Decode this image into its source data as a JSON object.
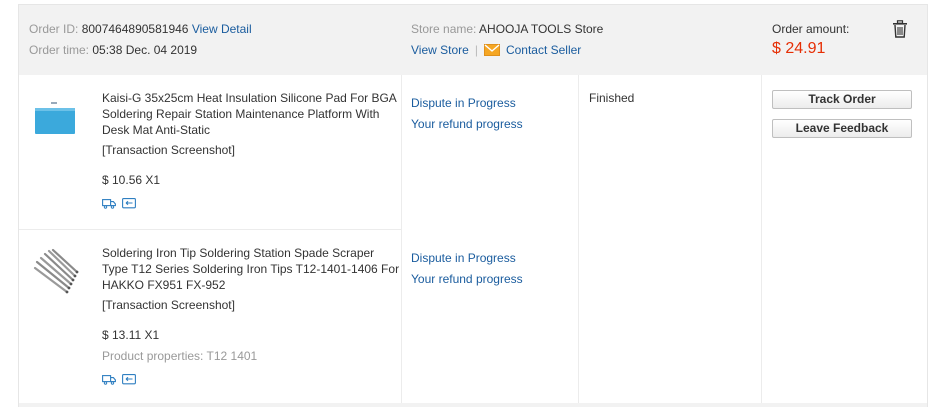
{
  "header": {
    "order_id_label": "Order ID:",
    "order_id": "8007464890581946",
    "view_detail": "View Detail",
    "order_time_label": "Order time:",
    "order_time": "05:38 Dec. 04 2019",
    "store_name_label": "Store name:",
    "store_name": "AHOOJA TOOLS Store",
    "view_store": "View Store",
    "separator": "|",
    "contact_seller": "Contact Seller",
    "order_amount_label": "Order amount:",
    "order_amount": "$ 24.91"
  },
  "items": [
    {
      "title": "Kaisi-G 35x25cm Heat Insulation Silicone Pad For BGA Soldering Repair Station Maintenance Platform With Desk Mat Anti-Static",
      "screenshot_link": "[Transaction Screenshot]",
      "price": "$ 10.56 X1",
      "dispute": "Dispute in Progress",
      "refund": "Your refund progress"
    },
    {
      "title": "Soldering Iron Tip Soldering Station Spade Scraper Type T12 Series Soldering Iron Tips T12-1401-1406 For HAKKO FX951 FX-952",
      "screenshot_link": "[Transaction Screenshot]",
      "price": "$ 13.11 X1",
      "properties": "Product properties: T12 1401",
      "dispute": "Dispute in Progress",
      "refund": "Your refund progress"
    }
  ],
  "order_status": "Finished",
  "actions": {
    "track_order": "Track Order",
    "leave_feedback": "Leave Feedback"
  },
  "colors": {
    "link": "#1a5c9e",
    "amount": "#e62e04",
    "header_bg": "#f2f2f2",
    "mail_icon": "#f5a623"
  },
  "icons": [
    "trash-icon",
    "mail-icon",
    "shipping-truck-icon",
    "return-icon"
  ]
}
